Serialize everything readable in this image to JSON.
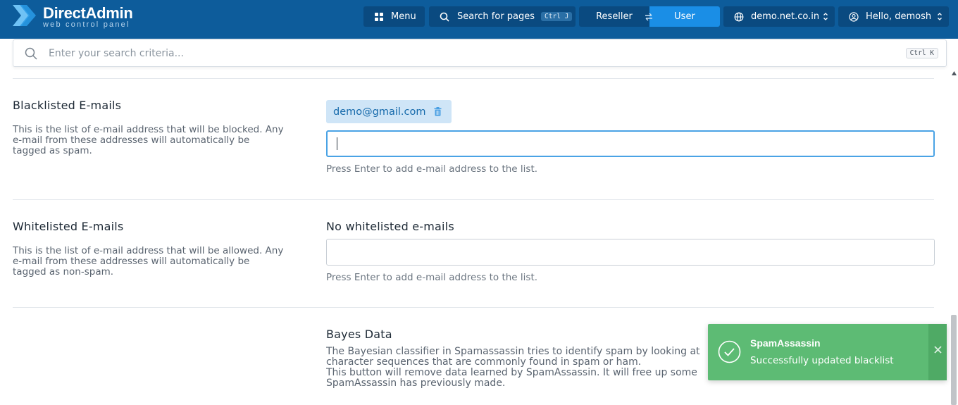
{
  "app": {
    "brand": "DirectAdmin",
    "brand_subtitle": "web control panel"
  },
  "topbar": {
    "menu_label": "Menu",
    "search_label": "Search for pages",
    "search_shortcut": "Ctrl J",
    "role_reseller": "Reseller",
    "role_user": "User",
    "role_active": "User",
    "domain": "demo.net.co.in",
    "greeting": "Hello, demosh"
  },
  "search": {
    "placeholder": "Enter your search criteria...",
    "shortcut": "Ctrl K"
  },
  "blacklist": {
    "title": "Blacklisted E-mails",
    "description_lines": [
      "This is the list of e-mail address that will be blocked. Any",
      "e-mail from these addresses will automatically be",
      "tagged as spam."
    ],
    "entries": [
      "demo@gmail.com"
    ],
    "input_value": "",
    "hint": "Press Enter to add e-mail address to the list."
  },
  "whitelist": {
    "title": "Whitelisted E-mails",
    "description_lines": [
      "This is the list of e-mail address that will be allowed. Any",
      "e-mail from these addresses will automatically be",
      "tagged as non-spam."
    ],
    "empty_label": "No whitelisted e-mails",
    "input_value": "",
    "hint": "Press Enter to add e-mail address to the list."
  },
  "bayes": {
    "title": "Bayes Data",
    "lines": [
      "The Bayesian classifier in Spamassassin tries to identify spam by looking at",
      "character sequences that are commonly found in spam or ham.",
      "This button will remove data learned by SpamAssassin. It will free up some",
      "SpamAssassin has previously made."
    ]
  },
  "toast": {
    "title": "SpamAssassin",
    "message": "Successfully updated blacklist",
    "color": "#5dbb74"
  },
  "colors": {
    "topbar": "#0d5c9b",
    "accent": "#1a8ee6",
    "chip_bg": "#cfe5f7"
  }
}
